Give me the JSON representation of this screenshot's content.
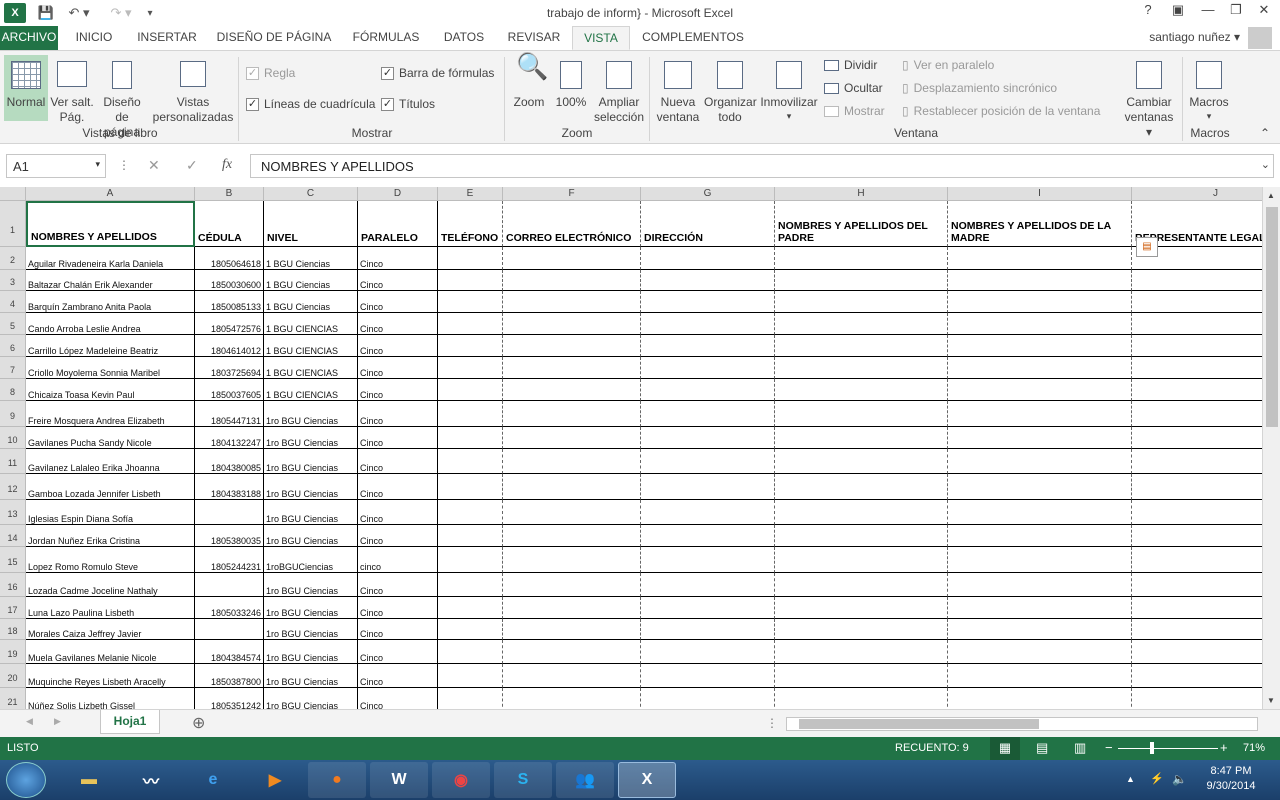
{
  "titlebar": {
    "title": "trabajo de inform} - Microsoft Excel",
    "help": "?",
    "minimize": "—",
    "restore": "❐",
    "close": "✕"
  },
  "tabs": [
    {
      "label": "ARCHIVO"
    },
    {
      "label": "INICIO"
    },
    {
      "label": "INSERTAR"
    },
    {
      "label": "DISEÑO DE PÁGINA"
    },
    {
      "label": "FÓRMULAS"
    },
    {
      "label": "DATOS"
    },
    {
      "label": "REVISAR"
    },
    {
      "label": "VISTA"
    },
    {
      "label": "COMPLEMENTOS"
    }
  ],
  "user": "santiago nuñez",
  "ribbon": {
    "normal": "Normal",
    "salto1": "Ver salt.",
    "salto2": "Pág.",
    "diseno1": "Diseño",
    "diseno2": "de página",
    "vistas1": "Vistas",
    "vistas2": "personalizadas",
    "grp_vistas": "Vistas de libro",
    "regla": "Regla",
    "barra": "Barra de fórmulas",
    "lineas": "Líneas de cuadrícula",
    "titulos": "Títulos",
    "grp_mostrar": "Mostrar",
    "zoom": "Zoom",
    "cien": "100%",
    "ampliar1": "Ampliar",
    "ampliar2": "selección",
    "grp_zoom": "Zoom",
    "nueva1": "Nueva",
    "nueva2": "ventana",
    "org1": "Organizar",
    "org2": "todo",
    "inmov": "Inmovilizar",
    "dividir": "Dividir",
    "ocultar": "Ocultar",
    "mostrar": "Mostrar",
    "paralelo": "Ver en paralelo",
    "desplaz": "Desplazamiento sincrónico",
    "restab": "Restablecer posición de la ventana",
    "cambiar1": "Cambiar",
    "cambiar2": "ventanas",
    "grp_ventana": "Ventana",
    "macros": "Macros",
    "grp_macros": "Macros"
  },
  "formula": {
    "namebox": "A1",
    "content": "NOMBRES Y APELLIDOS",
    "fx": "fx"
  },
  "columns": [
    "A",
    "B",
    "C",
    "D",
    "E",
    "F",
    "G",
    "H",
    "I",
    "J"
  ],
  "headers": [
    "NOMBRES Y APELLIDOS",
    "CÉDULA",
    "NIVEL",
    "PARALELO",
    "TELÉFONO",
    "CORREO ELECTRÓNICO",
    "DIRECCIÓN",
    "NOMBRES Y APELLIDOS DEL PADRE",
    "NOMBRES Y APELLIDOS DE LA MADRE",
    "REPRESENTANTE LEGAL"
  ],
  "rows": [
    {
      "n": "2",
      "name": "Aguilar Rivadeneira Karla Daniela",
      "ced": "1805064618",
      "nivel": "1 BGU Ciencias",
      "par": "Cinco"
    },
    {
      "n": "3",
      "name": "Baltazar Chalán Erik Alexander",
      "ced": "1850030600",
      "nivel": "1 BGU Ciencias",
      "par": "Cinco"
    },
    {
      "n": "4",
      "name": "Barquín Zambrano Anita Paola",
      "ced": "1850085133",
      "nivel": "1 BGU Ciencias",
      "par": "Cinco"
    },
    {
      "n": "5",
      "name": "Cando Arroba Leslie Andrea",
      "ced": "1805472576",
      "nivel": "1 BGU CIENCIAS",
      "par": "Cinco"
    },
    {
      "n": "6",
      "name": "Carrillo López Madeleine Beatriz",
      "ced": "1804614012",
      "nivel": "1 BGU CIENCIAS",
      "par": "Cinco"
    },
    {
      "n": "7",
      "name": "Criollo Moyolema Sonnia Maribel",
      "ced": "1803725694",
      "nivel": "1 BGU CIENCIAS",
      "par": "Cinco"
    },
    {
      "n": "8",
      "name": "Chicaiza Toasa Kevin Paul",
      "ced": "1850037605",
      "nivel": "1 BGU CIENCIAS",
      "par": "Cinco"
    },
    {
      "n": "9",
      "name": "Freire Mosquera Andrea Elizabeth",
      "ced": "1805447131",
      "nivel": "1ro BGU Ciencias",
      "par": "Cinco"
    },
    {
      "n": "10",
      "name": "Gavilanes Pucha Sandy Nicole",
      "ced": "1804132247",
      "nivel": "1ro BGU Ciencias",
      "par": "Cinco"
    },
    {
      "n": "11",
      "name": "Gavilanez Lalaleo Erika Jhoanna",
      "ced": "1804380085",
      "nivel": "1ro BGU Ciencias",
      "par": "Cinco"
    },
    {
      "n": "12",
      "name": "Gamboa Lozada Jennifer Lisbeth",
      "ced": "1804383188",
      "nivel": "1ro BGU Ciencias",
      "par": "Cinco"
    },
    {
      "n": "13",
      "name": "Iglesias Espin Diana Sofía",
      "ced": "",
      "nivel": "1ro BGU Ciencias",
      "par": "Cinco"
    },
    {
      "n": "14",
      "name": "Jordan Nuñez Erika Cristina",
      "ced": "1805380035",
      "nivel": "1ro BGU Ciencias",
      "par": "Cinco"
    },
    {
      "n": "15",
      "name": "Lopez Romo Romulo Steve",
      "ced": "1805244231",
      "nivel": "1roBGUCiencias",
      "par": "cinco"
    },
    {
      "n": "16",
      "name": "Lozada Cadme Joceline Nathaly",
      "ced": "",
      "nivel": "1ro BGU Ciencias",
      "par": "Cinco"
    },
    {
      "n": "17",
      "name": "Luna Lazo Paulina Lisbeth",
      "ced": "1805033246",
      "nivel": "1ro BGU Ciencias",
      "par": "Cinco"
    },
    {
      "n": "18",
      "name": "Morales Caiza Jeffrey Javier",
      "ced": "",
      "nivel": "1ro BGU Ciencias",
      "par": "Cinco"
    },
    {
      "n": "19",
      "name": "Muela Gavilanes Melanie Nicole",
      "ced": "1804384574",
      "nivel": "1ro BGU Ciencias",
      "par": "Cinco"
    },
    {
      "n": "20",
      "name": "Muquinche Reyes Lisbeth Aracelly",
      "ced": "1850387800",
      "nivel": "1ro BGU Ciencias",
      "par": "Cinco"
    },
    {
      "n": "21",
      "name": "Núñez Solis Lizbeth Gissel",
      "ced": "1805351242",
      "nivel": "1ro BGU Ciencias",
      "par": "Cinco"
    }
  ],
  "sheet": {
    "tab": "Hoja1",
    "add": "⊕"
  },
  "status": {
    "ready": "LISTO",
    "count": "RECUENTO: 9",
    "zoom": "71%"
  },
  "taskbar": {
    "time": "8:47 PM",
    "date": "9/30/2014"
  }
}
